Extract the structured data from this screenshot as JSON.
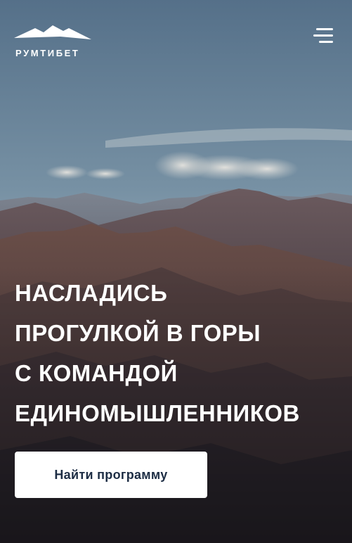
{
  "brand": {
    "name": "РУМТИБЕТ",
    "logo_icon": "mountain-logo-icon"
  },
  "header": {
    "menu_icon": "hamburger-menu-icon"
  },
  "hero": {
    "headline_lines": [
      "НАСЛАДИСЬ",
      "ПРОГУЛКОЙ В ГОРЫ",
      "С КОМАНДОЙ",
      "ЕДИНОМЫШЛЕННИКОВ"
    ],
    "cta_label": "Найти программу"
  },
  "colors": {
    "sky_top": "#5e7a94",
    "sky_bottom": "#b9c2c6",
    "mountain_dark": "#3a3438",
    "button_bg": "#ffffff",
    "button_text": "#1d2d44",
    "text": "#ffffff"
  }
}
